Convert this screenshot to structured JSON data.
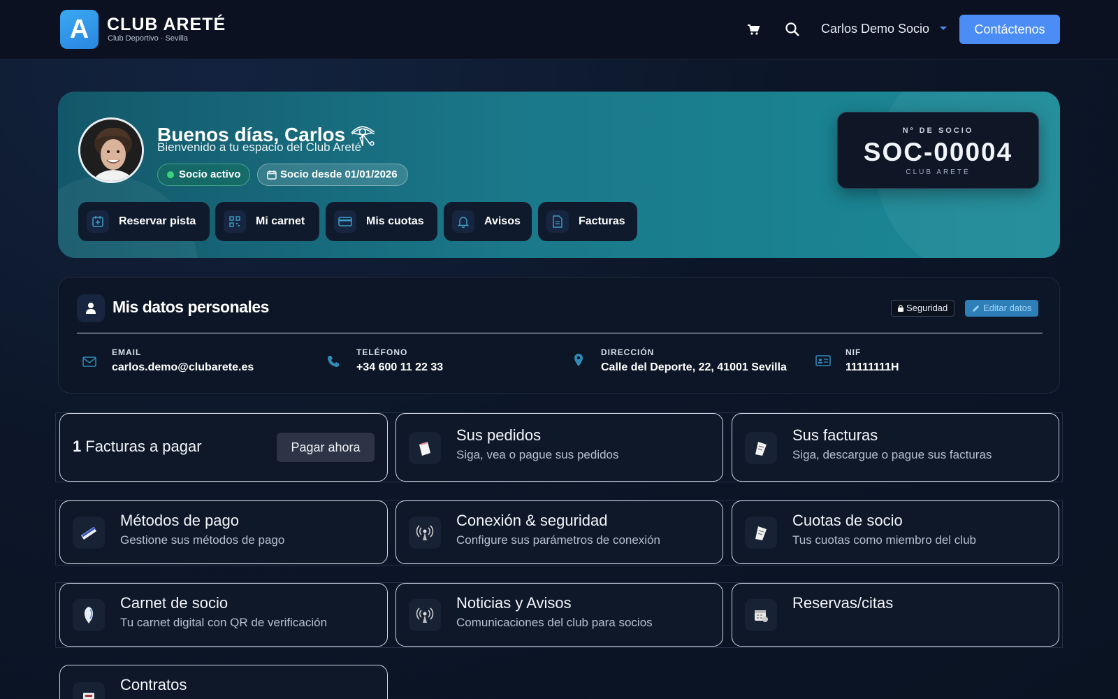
{
  "nav": {
    "logo_letter": "A",
    "brand_name": "CLUB ARETÉ",
    "brand_subtitle": "Club Deportivo · Sevilla",
    "user_name": "Carlos Demo Socio",
    "contact_label": "Contáctenos"
  },
  "hero": {
    "greeting": "Buenos días, Carlos 𓂀",
    "welcome": "Bienvenido a tu espacio del Club Areté",
    "badge_active": "Socio activo",
    "badge_since": "Socio desde 01/01/2026",
    "quick_actions": [
      {
        "label": "Reservar pista",
        "icon": "calendar-plus-icon"
      },
      {
        "label": "Mi carnet",
        "icon": "qr-icon"
      },
      {
        "label": "Mis cuotas",
        "icon": "credit-card-icon"
      },
      {
        "label": "Avisos",
        "icon": "bell-icon"
      },
      {
        "label": "Facturas",
        "icon": "document-icon"
      }
    ],
    "socio_card": {
      "label": "Nº DE SOCIO",
      "number": "SOC-00004",
      "club": "CLUB ARETÉ"
    }
  },
  "personal": {
    "title": "Mis datos personales",
    "security_label": "Seguridad",
    "edit_label": "Editar datos",
    "fields": [
      {
        "label": "EMAIL",
        "value": "carlos.demo@clubarete.es",
        "icon": "envelope-icon"
      },
      {
        "label": "TELÉFONO",
        "value": "+34 600 11 22 33",
        "icon": "phone-icon"
      },
      {
        "label": "DIRECCIÓN",
        "value": "Calle del Deporte, 22, 41001 Sevilla",
        "icon": "map-pin-icon"
      },
      {
        "label": "NIF",
        "value": "11111111H",
        "icon": "id-card-icon"
      }
    ]
  },
  "tiles": {
    "pay": {
      "count": "1",
      "label": "Facturas a pagar",
      "button": "Pagar ahora"
    },
    "items": [
      {
        "title": "Sus pedidos",
        "subtitle": "Siga, vea o pague sus pedidos",
        "icon": "shopping-bag-icon"
      },
      {
        "title": "Sus facturas",
        "subtitle": "Siga, descargue o pague sus facturas",
        "icon": "invoice-icon"
      },
      {
        "title": "Métodos de pago",
        "subtitle": "Gestione sus métodos de pago",
        "icon": "credit-card-icon"
      },
      {
        "title": "Conexión & seguridad",
        "subtitle": "Configure sus parámetros de conexión",
        "icon": "antenna-icon"
      },
      {
        "title": "Cuotas de socio",
        "subtitle": "Tus cuotas como miembro del club",
        "icon": "invoice-icon"
      },
      {
        "title": "Carnet de socio",
        "subtitle": "Tu carnet digital con QR de verificación",
        "icon": "badge-icon"
      },
      {
        "title": "Noticias y Avisos",
        "subtitle": "Comunicaciones del club para socios",
        "icon": "antenna-icon"
      },
      {
        "title": "Reservas/citas",
        "subtitle": "",
        "icon": "calendar-icon"
      },
      {
        "title": "Contratos",
        "subtitle": "",
        "icon": "contract-icon"
      }
    ]
  }
}
